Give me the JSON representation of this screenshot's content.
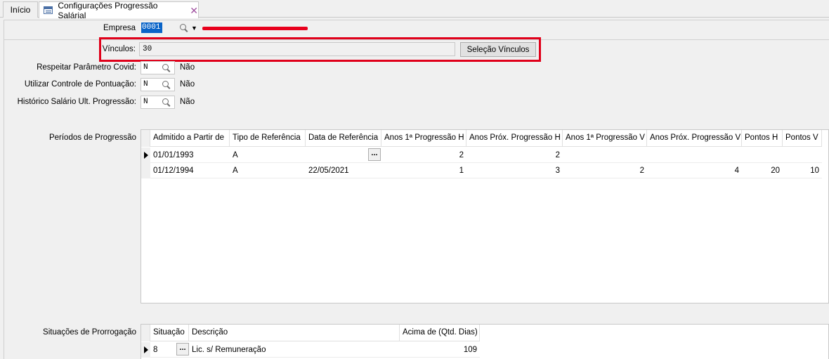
{
  "tabs": [
    {
      "label": "Início"
    },
    {
      "label": "Configurações Progressão Salárial"
    }
  ],
  "empresa": {
    "label": "Empresa",
    "code": "0001"
  },
  "vinculos": {
    "label": "Vínculos:",
    "value": "30",
    "button_label": "Seleção Vínculos"
  },
  "options": [
    {
      "label": "Respeitar Parâmetro Covid:",
      "value": "N",
      "text": "Não"
    },
    {
      "label": "Utilizar Controle de Pontuação:",
      "value": "N",
      "text": "Não"
    },
    {
      "label": "Histórico Salário Ult. Progressão:",
      "value": "N",
      "text": "Não"
    }
  ],
  "periodos": {
    "label": "Períodos de Progressão",
    "columns": [
      "Admitido a Partir de",
      "Tipo de Referência",
      "Data de Referência",
      "Anos 1ª Progressão H",
      "Anos Próx. Progressão H",
      "Anos 1ª Progressão V",
      "Anos Próx. Progressão V",
      "Pontos H",
      "Pontos V"
    ],
    "rows": [
      [
        "01/01/1993",
        "A",
        "",
        "2",
        "2",
        "",
        "",
        "",
        ""
      ],
      [
        "01/12/1994",
        "A",
        "22/05/2021",
        "1",
        "3",
        "2",
        "4",
        "20",
        "10"
      ]
    ]
  },
  "situacoes": {
    "label": "Situações de Prorrogação",
    "columns": [
      "Situação",
      "Descrição",
      "Acima de (Qtd. Dias)"
    ],
    "rows": [
      [
        "8",
        "Lic. s/ Remuneração",
        "109"
      ]
    ]
  },
  "colors": {
    "highlight": "#e0001a",
    "selection": "#0a64c8",
    "close_icon": "#a050a0"
  }
}
